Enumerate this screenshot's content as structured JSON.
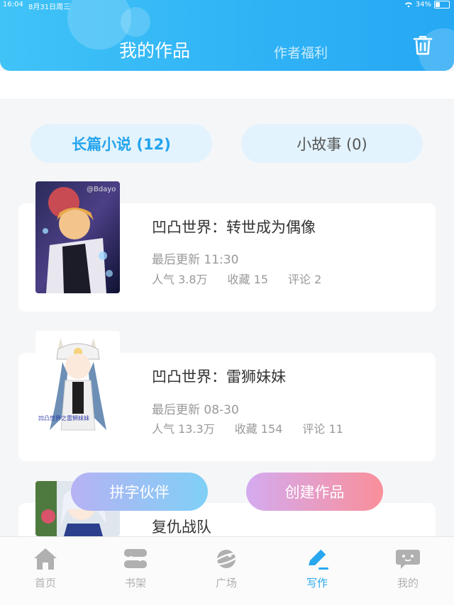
{
  "status_bar": {
    "time": "16:04",
    "date": "8月31日周三",
    "battery": "34%",
    "battery_level": 0.34
  },
  "header": {
    "tab_works": "我的作品",
    "tab_welfare": "作者福利",
    "delete_icon": "trash-icon"
  },
  "segments": {
    "novel": "长篇小说 (12)",
    "story": "小故事 (0)"
  },
  "works": [
    {
      "title": "凹凸世界：转世成为偶像",
      "updated": "最后更新 11:30",
      "popularity": "人气 3.8万",
      "favorites": "收藏 15",
      "comments": "评论 2",
      "cover_text": "@Bdayo"
    },
    {
      "title": "凹凸世界：雷狮妹妹",
      "updated": "最后更新 08-30",
      "popularity": "人气 13.3万",
      "favorites": "收藏 154",
      "comments": "评论 11",
      "cover_text": "凹凸世界之雷狮妹妹"
    },
    {
      "title": "复仇战队"
    }
  ],
  "actions": {
    "partner": "拼字伙伴",
    "create": "创建作品"
  },
  "tabbar": {
    "items": [
      {
        "label": "首页",
        "icon": "home-icon"
      },
      {
        "label": "书架",
        "icon": "bookshelf-icon"
      },
      {
        "label": "广场",
        "icon": "planet-icon"
      },
      {
        "label": "写作",
        "icon": "pen-icon"
      },
      {
        "label": "我的",
        "icon": "chat-face-icon"
      }
    ],
    "active_index": 3
  },
  "colors": {
    "accent": "#28a7ef",
    "header": "#2fb2f5",
    "inactive": "#b0b0b0"
  }
}
